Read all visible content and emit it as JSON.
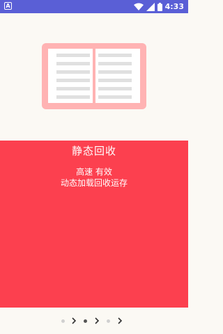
{
  "status_bar": {
    "left_badge": "A",
    "time": "4:33",
    "icons": [
      "wifi-icon",
      "signal-icon",
      "battery-icon"
    ]
  },
  "hero": {
    "icon": "open-book-icon"
  },
  "panel": {
    "title": "静态回收",
    "line1": "高速 有效",
    "line2": "动态加载回收运存"
  },
  "pager": {
    "pages": 3,
    "current_index": 1,
    "dot_icons": [
      "page-dot-icon",
      "page-dot-icon",
      "page-dot-icon"
    ],
    "arrow_icons": [
      "chevron-right-icon",
      "chevron-right-icon",
      "chevron-right-icon"
    ]
  },
  "colors": {
    "status_bar": "#5a5fd6",
    "background": "#fbf9f4",
    "panel": "#fc404f",
    "book_frame": "#ffb3b3",
    "book_lines": "#e0e0e0",
    "dot_active": "#555555",
    "dot_inactive": "#d0d0d0"
  }
}
